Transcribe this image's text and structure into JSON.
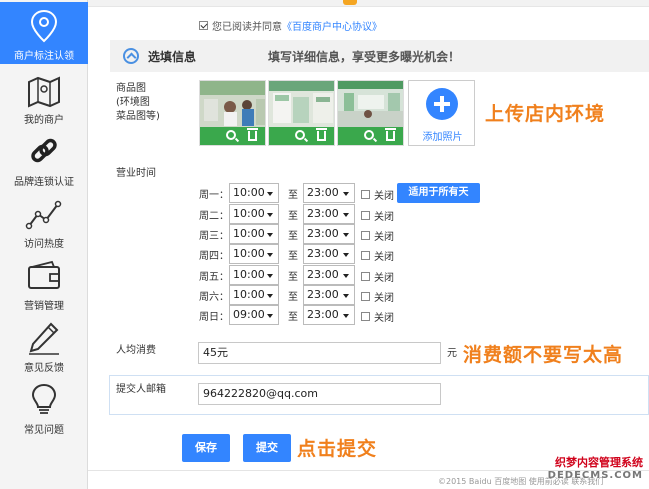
{
  "sidebar": {
    "items": [
      {
        "label": "商户标注认领",
        "icon": "map-pin-icon",
        "active": true
      },
      {
        "label": "我的商户",
        "icon": "map-icon",
        "active": false
      },
      {
        "label": "品牌连锁认证",
        "icon": "chain-link-icon",
        "active": false
      },
      {
        "label": "访问热度",
        "icon": "trend-line-icon",
        "active": false
      },
      {
        "label": "营销管理",
        "icon": "wallet-icon",
        "active": false
      },
      {
        "label": "意见反馈",
        "icon": "pencil-icon",
        "active": false
      },
      {
        "label": "常见问题",
        "icon": "lightbulb-icon",
        "active": false
      }
    ]
  },
  "consent": {
    "text": "您已阅读并同意",
    "link": "《百度商户中心协议》",
    "checked": true
  },
  "section": {
    "title": "选填信息",
    "hint": "填写详细信息，享受更多曝光机会！"
  },
  "photos": {
    "label_lines": [
      "商品图",
      "(环境图",
      "菜品图等)"
    ],
    "add_label": "添加照片",
    "annotation": "上传店内环境"
  },
  "hours": {
    "label": "营业时间",
    "to_label": "至",
    "closed_label": "关闭",
    "apply_all": "适用于所有天",
    "rows": [
      {
        "day": "周一：",
        "open": "10:00",
        "close": "23:00"
      },
      {
        "day": "周二：",
        "open": "10:00",
        "close": "23:00"
      },
      {
        "day": "周三：",
        "open": "10:00",
        "close": "23:00"
      },
      {
        "day": "周四：",
        "open": "10:00",
        "close": "23:00"
      },
      {
        "day": "周五：",
        "open": "10:00",
        "close": "23:00"
      },
      {
        "day": "周六：",
        "open": "10:00",
        "close": "23:00"
      },
      {
        "day": "周日：",
        "open": "09:00",
        "close": "23:00"
      }
    ]
  },
  "avg_spend": {
    "label": "人均消费",
    "value": "45元",
    "unit": "元",
    "annotation": "消费额不要写太高"
  },
  "email": {
    "label": "提交人邮箱",
    "value": "964222820@qq.com"
  },
  "actions": {
    "save": "保存",
    "submit": "提交",
    "annotation": "点击提交"
  },
  "footer": {
    "copyright": "©2015 Baidu  百度地图  使用前必读  联系我们"
  },
  "watermark": {
    "line1": "织梦内容管理系统",
    "line2": "DEDECMS.COM"
  },
  "colors": {
    "accent": "#3385ff",
    "annotation": "#f0801d",
    "photo_bar": "#3aa84c"
  }
}
